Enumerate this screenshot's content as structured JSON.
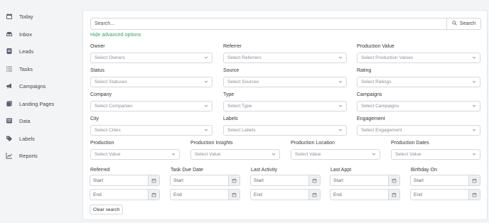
{
  "sidebar": {
    "items": [
      {
        "label": "Today",
        "icon": "calendar-icon"
      },
      {
        "label": "Inbox",
        "icon": "inbox-icon"
      },
      {
        "label": "Leads",
        "icon": "leads-icon"
      },
      {
        "label": "Tasks",
        "icon": "tasks-icon"
      },
      {
        "label": "Campaigns",
        "icon": "megaphone-icon"
      },
      {
        "label": "Landing Pages",
        "icon": "landing-pages-icon"
      },
      {
        "label": "Data",
        "icon": "data-icon"
      },
      {
        "label": "Labels",
        "icon": "tag-icon"
      },
      {
        "label": "Reports",
        "icon": "chart-icon"
      }
    ]
  },
  "search": {
    "placeholder": "Search...",
    "button_label": "Search",
    "advanced_toggle": "Hide advanced options"
  },
  "filters": {
    "owner": {
      "label": "Owner",
      "placeholder": "Select Owners"
    },
    "referrer": {
      "label": "Referrer",
      "placeholder": "Select Referrers"
    },
    "production_value": {
      "label": "Production Value",
      "placeholder": "Select Production Values"
    },
    "status": {
      "label": "Status",
      "placeholder": "Select Statuses"
    },
    "source": {
      "label": "Source",
      "placeholder": "Select Sources"
    },
    "rating": {
      "label": "Rating",
      "placeholder": "Select Ratings"
    },
    "company": {
      "label": "Company",
      "placeholder": "Select Companies"
    },
    "type": {
      "label": "Type",
      "placeholder": "Select Type"
    },
    "campaigns": {
      "label": "Campaigns",
      "placeholder": "Select Campaigns"
    },
    "city": {
      "label": "City",
      "placeholder": "Select Cities"
    },
    "labels": {
      "label": "Labels",
      "placeholder": "Select Labels"
    },
    "engagement": {
      "label": "Engagement",
      "placeholder": "Select Engagement"
    },
    "production": {
      "label": "Production",
      "placeholder": "Select Value"
    },
    "production_insights": {
      "label": "Production Insights",
      "placeholder": "Select Value"
    },
    "production_location": {
      "label": "Production Location",
      "placeholder": "Select Value"
    },
    "production_dates": {
      "label": "Production Dates",
      "placeholder": "Select Value"
    }
  },
  "date_filters": {
    "start_placeholder": "Start",
    "end_placeholder": "End",
    "referred": {
      "label": "Referred"
    },
    "task_due_date": {
      "label": "Task Due Date"
    },
    "last_activity": {
      "label": "Last Activity"
    },
    "last_appt": {
      "label": "Last Appt"
    },
    "birthday_on": {
      "label": "Birthday On"
    }
  },
  "actions": {
    "clear_label": "Clear search"
  },
  "colors": {
    "accent_green": "#2fa36b",
    "sidebar_icon": "#5a6270"
  }
}
